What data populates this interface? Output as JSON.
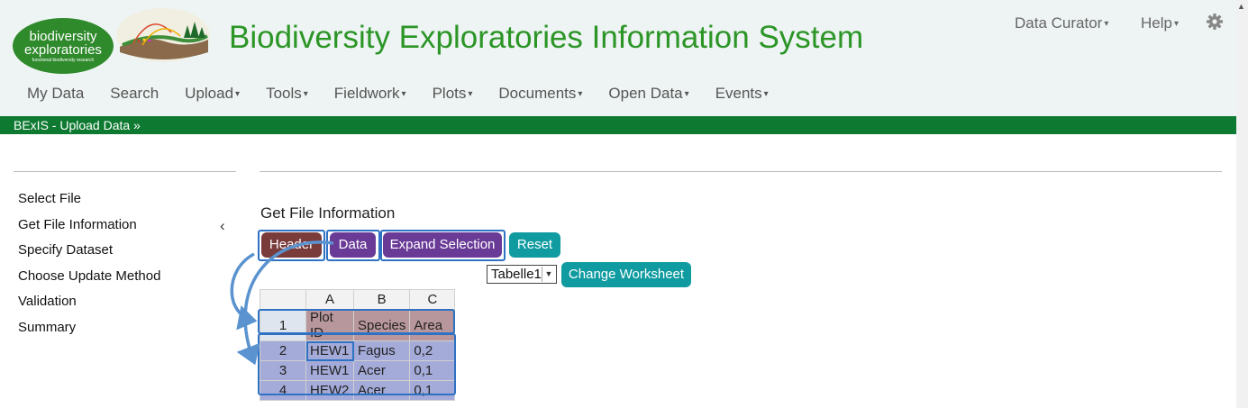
{
  "header": {
    "logo_line1": "biodiversity",
    "logo_line2": "exploratories",
    "logo_tag": "functional biodiversity research",
    "title": "Biodiversity Exploratories Information System",
    "user_menu": "Data Curator",
    "help_menu": "Help",
    "gear": "gear-icon"
  },
  "nav": [
    "My Data",
    "Search",
    "Upload",
    "Tools",
    "Fieldwork",
    "Plots",
    "Documents",
    "Open Data",
    "Events"
  ],
  "banner": "BExIS - Upload Data »",
  "steps": [
    "Select File",
    "Get File Information",
    "Specify Dataset",
    "Choose Update Method",
    "Validation",
    "Summary"
  ],
  "active_step_marker": "‹",
  "main": {
    "title": "Get File Information",
    "buttons": {
      "header": "Header",
      "data": "Data",
      "expand": "Expand Selection",
      "reset": "Reset",
      "change_ws": "Change Worksheet"
    },
    "worksheet": "Tabelle1"
  },
  "grid": {
    "columns": [
      "A",
      "B",
      "C"
    ],
    "rows": [
      [
        "1",
        "Plot ID",
        "Species",
        "Area"
      ],
      [
        "2",
        "HEW1",
        "Fagus",
        "0,2"
      ],
      [
        "3",
        "HEW1",
        "Acer",
        "0,1"
      ],
      [
        "4",
        "HEW2",
        "Acer",
        "0,1"
      ]
    ]
  },
  "colors": {
    "brand_green": "#2b9526",
    "banner_green": "#0e7a31",
    "header_btn": "#7a3b3b",
    "data_btn": "#6a3a97",
    "teal_btn": "#0f9ba0",
    "selection_blue": "#2f72c4"
  }
}
